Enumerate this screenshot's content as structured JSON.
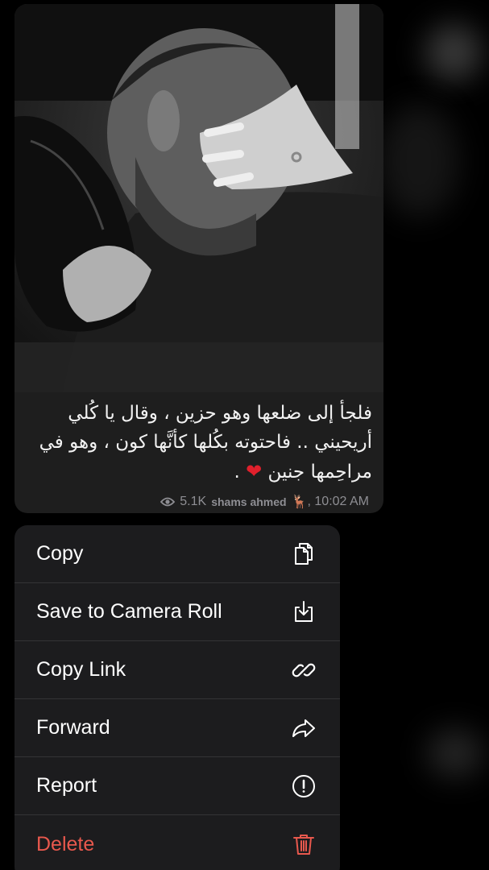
{
  "message": {
    "caption": "فلجأ إلى ضلعها وهو حزين ، وقال يا كُلي أريحيني .. فاحتوته بكُلها كأنَّها كون ، وهو في مراحِمها جنين",
    "caption_suffix": ".",
    "views": "5.1K",
    "author": "shams ahmed",
    "author_emoji": "🦌",
    "time": ", 10:02 AM"
  },
  "context_menu": {
    "items": [
      {
        "label": "Copy",
        "icon": "copy-icon"
      },
      {
        "label": "Save to Camera Roll",
        "icon": "save-download-icon"
      },
      {
        "label": "Copy Link",
        "icon": "link-icon"
      },
      {
        "label": "Forward",
        "icon": "forward-arrow-icon"
      },
      {
        "label": "Report",
        "icon": "report-exclamation-icon"
      },
      {
        "label": "Delete",
        "icon": "trash-icon"
      }
    ]
  },
  "colors": {
    "menu_background": "#1c1c1e",
    "bubble_background": "#1e1e1e",
    "destructive": "#e8584d",
    "heart": "#e0202c"
  }
}
